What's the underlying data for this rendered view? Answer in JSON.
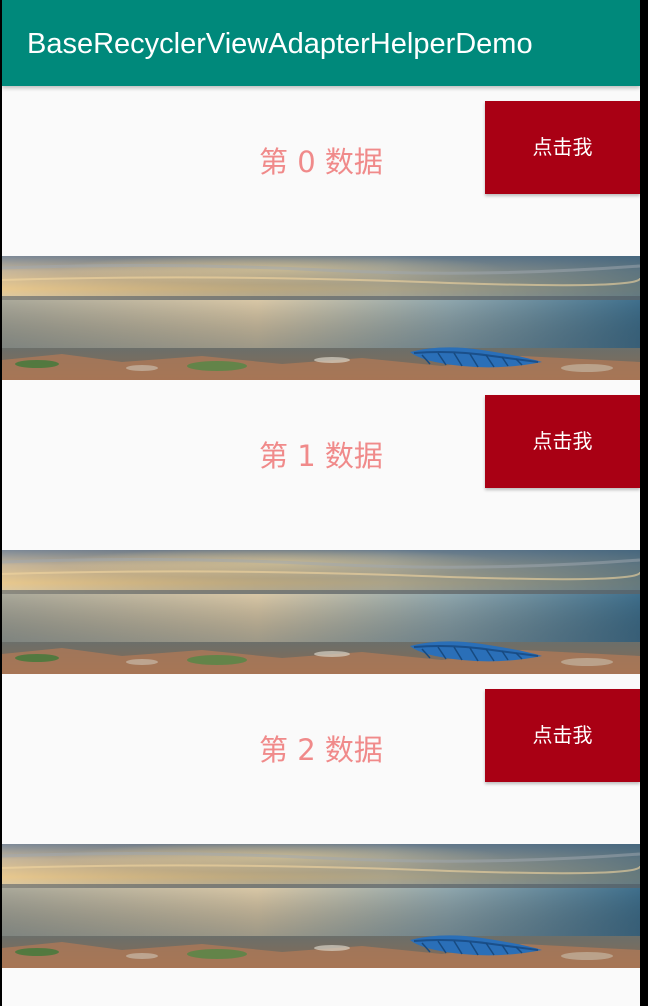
{
  "app_bar": {
    "title": "BaseRecyclerViewAdapterHelperDemo",
    "color": "#00897b"
  },
  "list": {
    "items": [
      {
        "text": "第 0 数据",
        "button_label": "点击我"
      },
      {
        "text": "第 1 数据",
        "button_label": "点击我"
      },
      {
        "text": "第 2 数据",
        "button_label": "点击我"
      }
    ]
  },
  "colors": {
    "item_text": "#f08a8a",
    "button_bg": "#a90014",
    "button_text": "#ffffff",
    "background": "#fafafa"
  },
  "banner": {
    "icon": "seascape-sunset-photo"
  }
}
